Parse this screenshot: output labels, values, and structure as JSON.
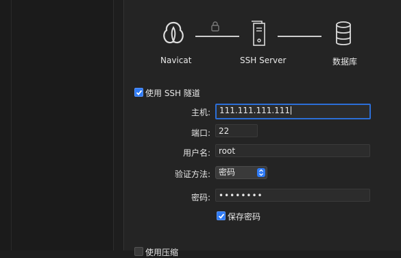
{
  "diagram": {
    "navicat_label": "Navicat",
    "ssh_server_label": "SSH Server",
    "database_label": "数据库"
  },
  "ssh": {
    "use_ssh_tunnel_label": "使用 SSH 隧道",
    "host_label": "主机:",
    "host_value": "111.111.111.111",
    "port_label": "端口:",
    "port_value": "22",
    "username_label": "用户名:",
    "username_value": "root",
    "auth_method_label": "验证方法:",
    "auth_method_value": "密码",
    "password_label": "密码:",
    "password_value": "••••••••",
    "save_password_label": "保存密码",
    "next_option_label": "使用压缩"
  },
  "colors": {
    "accent": "#2f7bf6",
    "background": "#242424"
  },
  "icons": {
    "navicat": "navicat-logo-icon",
    "lock": "lock-icon",
    "server": "server-icon",
    "database": "database-icon"
  }
}
